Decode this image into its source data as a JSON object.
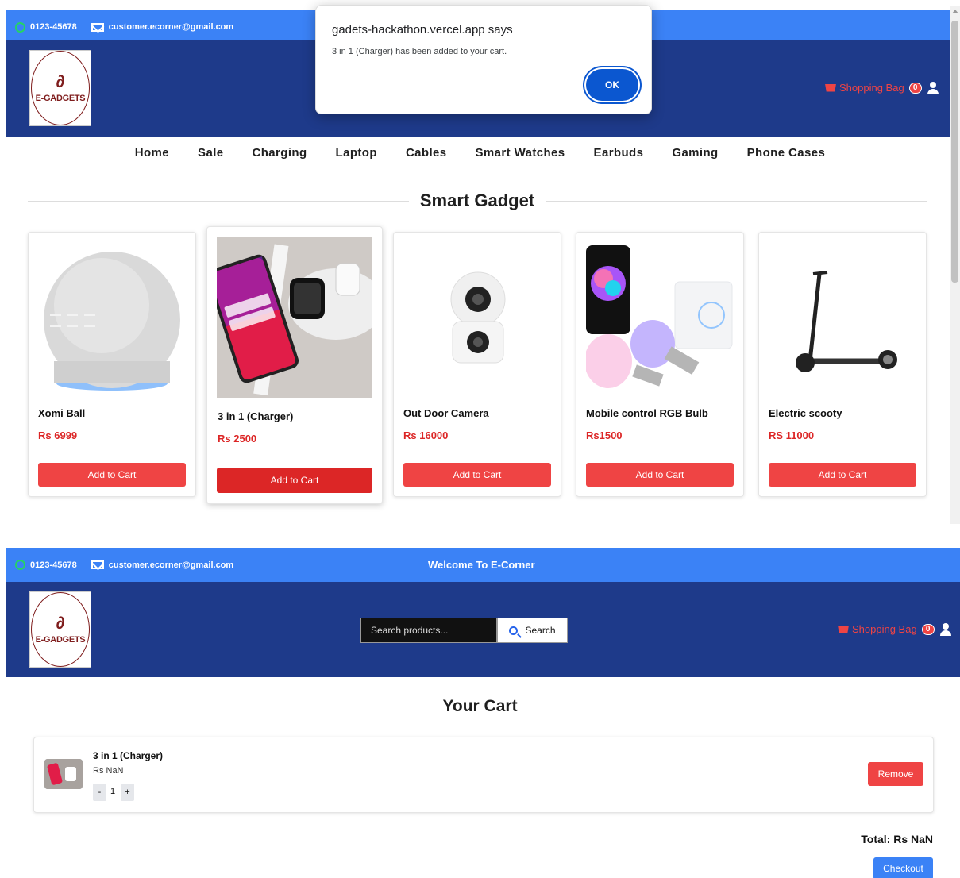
{
  "topbar": {
    "phone": "0123-45678",
    "email": "customer.ecorner@gmail.com",
    "welcome": "Welcome To E-Corner"
  },
  "brand": {
    "logo_text": "E-GADGETS"
  },
  "header": {
    "bag_label": "Shopping Bag",
    "bag_count": "0"
  },
  "nav": [
    "Home",
    "Sale",
    "Charging",
    "Laptop",
    "Cables",
    "Smart Watches",
    "Earbuds",
    "Gaming",
    "Phone Cases"
  ],
  "section_title": "Smart Gadget",
  "products": [
    {
      "name": "Xomi Ball",
      "price": "Rs 6999",
      "button": "Add to Cart"
    },
    {
      "name": "3 in 1 (Charger)",
      "price": "Rs 2500",
      "button": "Add to Cart"
    },
    {
      "name": "Out Door Camera",
      "price": "Rs 16000",
      "button": "Add to Cart"
    },
    {
      "name": "Mobile control RGB Bulb",
      "price": "Rs1500",
      "button": "Add to Cart"
    },
    {
      "name": "Electric scooty",
      "price": "RS 11000",
      "button": "Add to Cart"
    }
  ],
  "dialog": {
    "title": "gadets-hackathon.vercel.app says",
    "message": "3 in 1 (Charger) has been added to your cart.",
    "ok": "OK"
  },
  "search": {
    "placeholder": "Search products...",
    "button": "Search"
  },
  "cart": {
    "title": "Your Cart",
    "item": {
      "name": "3 in 1 (Charger)",
      "price": "Rs NaN",
      "qty": "1",
      "minus": "-",
      "plus": "+",
      "remove": "Remove"
    },
    "total": "Total: Rs NaN",
    "checkout": "Checkout"
  },
  "colors": {
    "topbar": "#3b82f6",
    "header": "#1e3a8a",
    "accent": "#ef4444",
    "price": "#dc2626",
    "checkout": "#3b82f6"
  }
}
